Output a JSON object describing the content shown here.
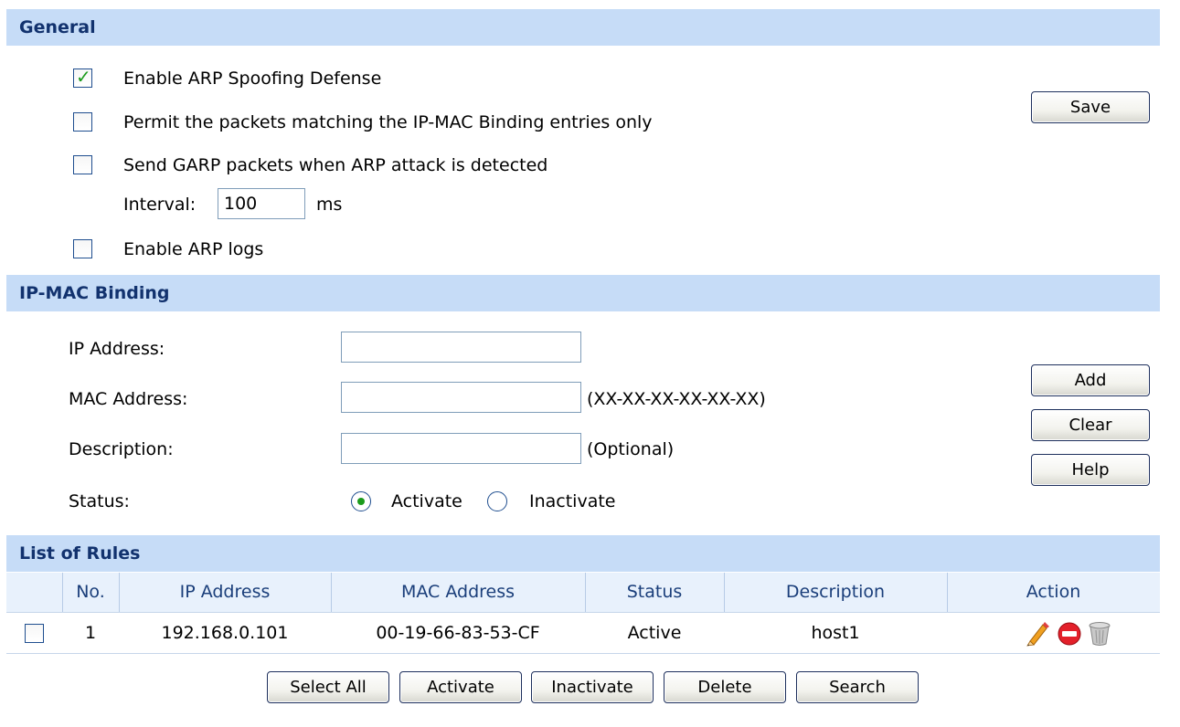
{
  "general": {
    "header": "General",
    "enable_arp_spoofing": {
      "label": "Enable ARP Spoofing Defense",
      "checked": true
    },
    "permit_packets": {
      "label": "Permit the packets matching the IP-MAC Binding entries only",
      "checked": false
    },
    "send_garp": {
      "label": "Send GARP packets when ARP attack is detected",
      "checked": false
    },
    "interval": {
      "label": "Interval:",
      "value": "100",
      "unit": "ms"
    },
    "enable_arp_logs": {
      "label": "Enable ARP logs",
      "checked": false
    },
    "save_label": "Save"
  },
  "binding": {
    "header": "IP-MAC Binding",
    "ip_label": "IP Address:",
    "ip_value": "",
    "mac_label": "MAC Address:",
    "mac_value": "",
    "mac_hint": "(XX-XX-XX-XX-XX-XX)",
    "desc_label": "Description:",
    "desc_value": "",
    "desc_hint": "(Optional)",
    "status_label": "Status:",
    "status_options": [
      "Activate",
      "Inactivate"
    ],
    "status_selected": "Activate",
    "add_label": "Add",
    "clear_label": "Clear",
    "help_label": "Help"
  },
  "rules": {
    "header": "List of Rules",
    "columns": [
      "No.",
      "IP Address",
      "MAC Address",
      "Status",
      "Description",
      "Action"
    ],
    "rows": [
      {
        "no": "1",
        "ip": "192.168.0.101",
        "mac": "00-19-66-83-53-CF",
        "status": "Active",
        "description": "host1",
        "checked": false,
        "actions": [
          "edit-icon",
          "inactivate-icon",
          "delete-icon"
        ]
      }
    ],
    "buttons": {
      "select_all": "Select All",
      "activate": "Activate",
      "inactivate": "Inactivate",
      "delete": "Delete",
      "search": "Search"
    }
  },
  "colors": {
    "header_bg": "#c6dcf7",
    "header_text": "#12326e",
    "check_green": "#1c9b1c"
  }
}
